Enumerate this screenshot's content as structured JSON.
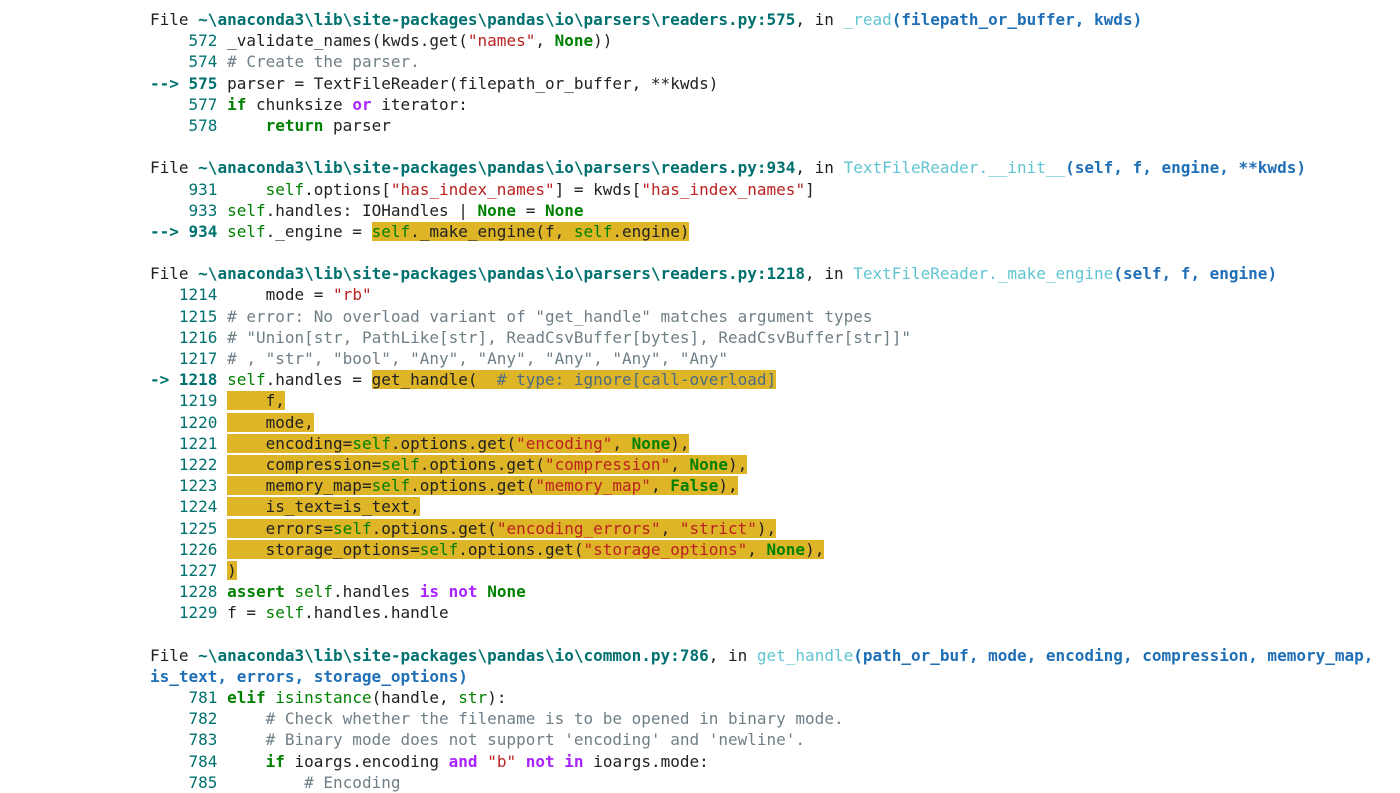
{
  "traceback": {
    "frames": [
      {
        "file_prefix": "File ",
        "path": "~\\anaconda3\\lib\\site-packages\\pandas\\io\\parsers\\readers.py:575",
        "in_text": ", in ",
        "func": "_read",
        "args": "(filepath_or_buffer, kwds)",
        "lines": [
          {
            "marker": "    ",
            "no": "572",
            "current": false,
            "code": "_validate_names(kwds.get(\"names\", None))"
          },
          {
            "marker": "    ",
            "no": "574",
            "current": false,
            "code": "# Create the parser."
          },
          {
            "marker": "--> ",
            "no": "575",
            "current": true,
            "code": "parser = TextFileReader(filepath_or_buffer, **kwds)"
          },
          {
            "marker": "    ",
            "no": "577",
            "current": false,
            "code": "if chunksize or iterator:"
          },
          {
            "marker": "    ",
            "no": "578",
            "current": false,
            "code": "    return parser"
          }
        ]
      },
      {
        "file_prefix": "File ",
        "path": "~\\anaconda3\\lib\\site-packages\\pandas\\io\\parsers\\readers.py:934",
        "in_text": ", in ",
        "func": "TextFileReader.__init__",
        "args": "(self, f, engine, **kwds)",
        "lines": [
          {
            "marker": "    ",
            "no": "931",
            "current": false,
            "code": "    self.options[\"has_index_names\"] = kwds[\"has_index_names\"]"
          },
          {
            "marker": "    ",
            "no": "933",
            "current": false,
            "code": "self.handles: IOHandles | None = None"
          },
          {
            "marker": "--> ",
            "no": "934",
            "current": true,
            "code": "self._engine = self._make_engine(f, self.engine)"
          }
        ]
      },
      {
        "file_prefix": "File ",
        "path": "~\\anaconda3\\lib\\site-packages\\pandas\\io\\parsers\\readers.py:1218",
        "in_text": ", in ",
        "func": "TextFileReader._make_engine",
        "args": "(self, f, engine)",
        "lines": [
          {
            "marker": "   ",
            "no": "1214",
            "current": false,
            "code": "    mode = \"rb\""
          },
          {
            "marker": "   ",
            "no": "1215",
            "current": false,
            "code": "# error: No overload variant of \"get_handle\" matches argument types"
          },
          {
            "marker": "   ",
            "no": "1216",
            "current": false,
            "code": "# \"Union[str, PathLike[str], ReadCsvBuffer[bytes], ReadCsvBuffer[str]]\""
          },
          {
            "marker": "   ",
            "no": "1217",
            "current": false,
            "code": "# , \"str\", \"bool\", \"Any\", \"Any\", \"Any\", \"Any\", \"Any\""
          },
          {
            "marker": "-> ",
            "no": "1218",
            "current": true,
            "code": "self.handles = get_handle(  # type: ignore[call-overload]"
          },
          {
            "marker": "   ",
            "no": "1219",
            "current": false,
            "code": "    f,"
          },
          {
            "marker": "   ",
            "no": "1220",
            "current": false,
            "code": "    mode,"
          },
          {
            "marker": "   ",
            "no": "1221",
            "current": false,
            "code": "    encoding=self.options.get(\"encoding\", None),"
          },
          {
            "marker": "   ",
            "no": "1222",
            "current": false,
            "code": "    compression=self.options.get(\"compression\", None),"
          },
          {
            "marker": "   ",
            "no": "1223",
            "current": false,
            "code": "    memory_map=self.options.get(\"memory_map\", False),"
          },
          {
            "marker": "   ",
            "no": "1224",
            "current": false,
            "code": "    is_text=is_text,"
          },
          {
            "marker": "   ",
            "no": "1225",
            "current": false,
            "code": "    errors=self.options.get(\"encoding_errors\", \"strict\"),"
          },
          {
            "marker": "   ",
            "no": "1226",
            "current": false,
            "code": "    storage_options=self.options.get(\"storage_options\", None),"
          },
          {
            "marker": "   ",
            "no": "1227",
            "current": false,
            "code": ")"
          },
          {
            "marker": "   ",
            "no": "1228",
            "current": false,
            "code": "assert self.handles is not None"
          },
          {
            "marker": "   ",
            "no": "1229",
            "current": false,
            "code": "f = self.handles.handle"
          }
        ]
      },
      {
        "file_prefix": "File ",
        "path": "~\\anaconda3\\lib\\site-packages\\pandas\\io\\common.py:786",
        "in_text": ", in ",
        "func": "get_handle",
        "args": "(path_or_buf, mode, encoding, compression, memory_map,",
        "args_cont": "is_text, errors, storage_options)",
        "lines": [
          {
            "marker": "    ",
            "no": "781",
            "current": false,
            "code": "elif isinstance(handle, str):"
          },
          {
            "marker": "    ",
            "no": "782",
            "current": false,
            "code": "    # Check whether the filename is to be opened in binary mode."
          },
          {
            "marker": "    ",
            "no": "783",
            "current": false,
            "code": "    # Binary mode does not support 'encoding' and 'newline'."
          },
          {
            "marker": "    ",
            "no": "784",
            "current": false,
            "code": "    if ioargs.encoding and \"b\" not in ioargs.mode:"
          },
          {
            "marker": "    ",
            "no": "785",
            "current": false,
            "code": "        # Encoding"
          }
        ]
      }
    ],
    "highlight": {
      "frame1_line934": "self._make_engine(f, self.engine)",
      "frame2_from": 1218,
      "frame2_to": 1227
    },
    "colors": {
      "highlight_bg": "#dfb528",
      "path_teal": "#00716f",
      "func_cyan": "#60c5d1",
      "args_blue": "#1f6fb7",
      "keyword_green": "#008000",
      "operator_purple": "#aa22ff",
      "string_red": "#ba2121",
      "comment_gray": "#6f7f86"
    }
  }
}
